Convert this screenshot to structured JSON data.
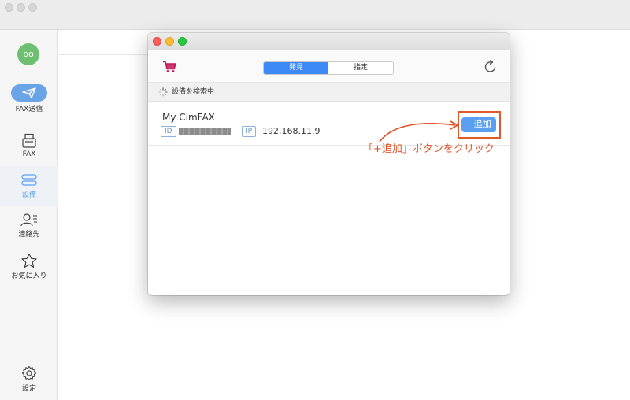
{
  "sidebar": {
    "avatar_initials": "bo",
    "items": [
      {
        "label": "FAX送信",
        "icon": "paper-plane-icon",
        "active": false
      },
      {
        "label": "FAX",
        "icon": "fax-machine-icon",
        "active": false
      },
      {
        "label": "設備",
        "icon": "device-list-icon",
        "active": true
      },
      {
        "label": "連絡先",
        "icon": "contacts-icon",
        "active": false
      },
      {
        "label": "お気に入り",
        "icon": "star-icon",
        "active": false
      }
    ],
    "settings_label": "設定"
  },
  "modal": {
    "tabs": [
      {
        "label": "発見",
        "selected": true
      },
      {
        "label": "指定",
        "selected": false
      }
    ],
    "status_text": "設備を検索中",
    "device": {
      "name": "My CimFAX",
      "id_tag": "ID",
      "ip_tag": "IP",
      "ip_value": "192.168.11.9",
      "add_label": "+ 追加"
    }
  },
  "annotation": {
    "text": "「+追加」ボタンをクリック",
    "color": "#e0522a"
  },
  "colors": {
    "accent": "#3d8af7",
    "cart": "#c2185b",
    "avatar": "#6fbf73"
  }
}
